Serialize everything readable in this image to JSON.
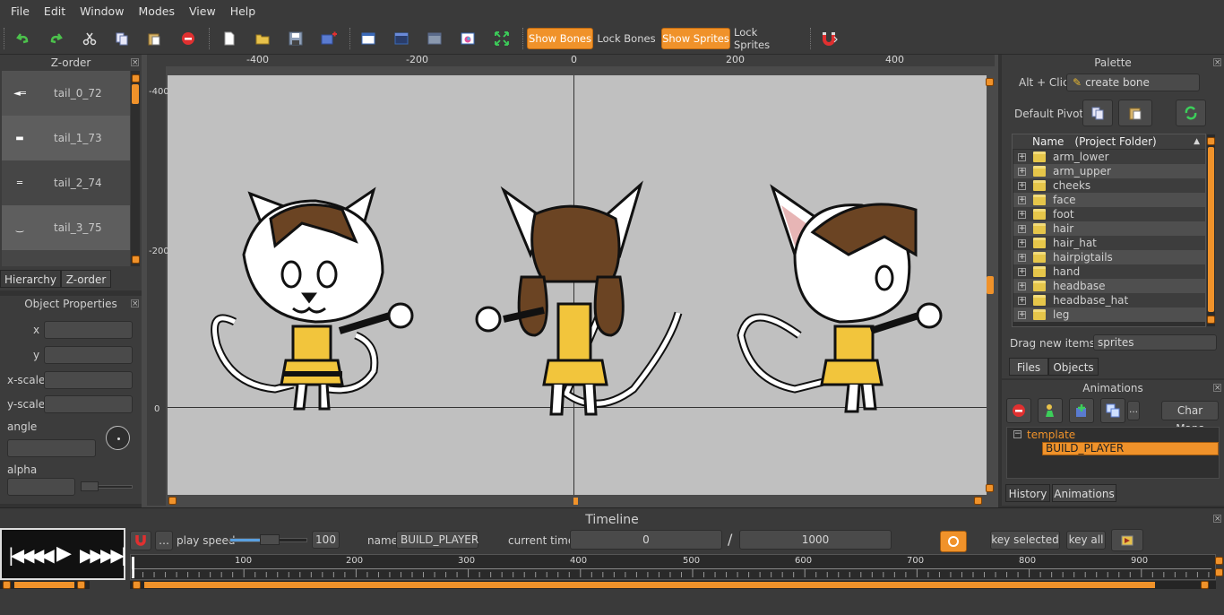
{
  "menu": [
    "File",
    "Edit",
    "Window",
    "Modes",
    "View",
    "Help"
  ],
  "toolbar": {
    "show_bones": "Show Bones",
    "lock_bones": "Lock Bones",
    "show_sprites": "Show Sprites",
    "lock_sprites": "Lock Sprites"
  },
  "zorder": {
    "title": "Z-order",
    "items": [
      {
        "label": "tail_0_72"
      },
      {
        "label": "tail_1_73"
      },
      {
        "label": "tail_2_74"
      },
      {
        "label": "tail_3_75"
      }
    ],
    "tab_hierarchy": "Hierarchy",
    "tab_zorder": "Z-order"
  },
  "object_props": {
    "title": "Object Properties",
    "x": "x",
    "y": "y",
    "xscale": "x-scale",
    "yscale": "y-scale",
    "angle": "angle",
    "alpha": "alpha"
  },
  "ruler": {
    "top": [
      "-400",
      "-200",
      "0",
      "200",
      "400"
    ],
    "left": [
      "-400",
      "-200",
      "0"
    ]
  },
  "palette": {
    "title": "Palette",
    "alt_click": "Alt + Click:",
    "create_bone": "create bone",
    "default_pivot": "Default Pivot:",
    "col_name": "Name",
    "col_folder": "(Project Folder)",
    "folders": [
      "arm_lower",
      "arm_upper",
      "cheeks",
      "face",
      "foot",
      "hair",
      "hair_hat",
      "hairpigtails",
      "hand",
      "headbase",
      "headbase_hat",
      "leg"
    ],
    "drag_label": "Drag new items as",
    "drag_value": "sprites",
    "tab_files": "Files",
    "tab_objects": "Objects"
  },
  "animations": {
    "title": "Animations",
    "char_maps": "Char Maps",
    "tree_root": "template",
    "tree_child": "BUILD_PLAYER",
    "tab_history": "History",
    "tab_animations": "Animations"
  },
  "timeline": {
    "title": "Timeline",
    "play_speed_label": "play speed",
    "play_speed_value": "100",
    "play_speed": 0.4,
    "name_label": "name",
    "name_value": "BUILD_PLAYER",
    "current_time_label": "current time:",
    "current_time": "0",
    "slash": "/",
    "total_time": "1000",
    "key_selected": "key selected",
    "key_all": "key all",
    "ticks": [
      "100",
      "200",
      "300",
      "400",
      "500",
      "600",
      "700",
      "800",
      "900"
    ]
  },
  "colors": {
    "accent": "#f0922a",
    "canvas": "#c0c0c0",
    "panel": "#3c3c3c"
  }
}
